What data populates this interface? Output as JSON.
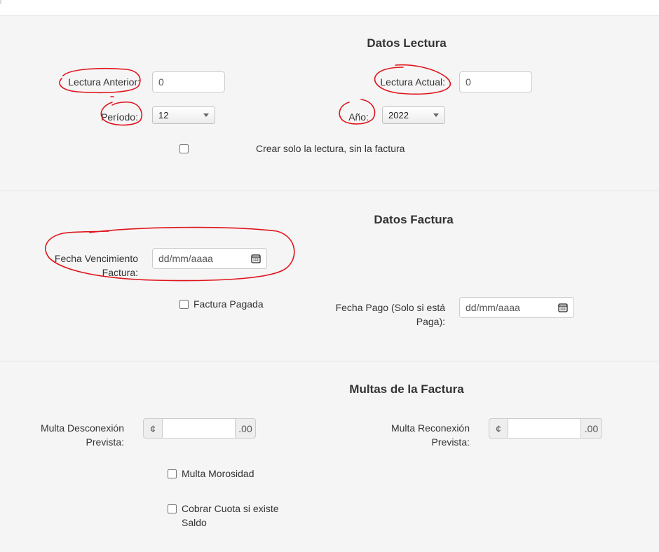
{
  "lectura": {
    "title": "Datos Lectura",
    "anterior_label": "Lectura Anterior:",
    "anterior_value": "0",
    "actual_label": "Lectura Actual:",
    "actual_value": "0",
    "periodo_label": "Período:",
    "periodo_value": "12",
    "anio_label": "Año:",
    "anio_value": "2022",
    "solo_lectura_label": "Crear solo la lectura, sin la factura"
  },
  "factura": {
    "title": "Datos Factura",
    "vencimiento_label_line1": "Fecha Vencimiento",
    "vencimiento_label_line2": "Factura:",
    "vencimiento_placeholder": "dd/mm/aaaa",
    "pagada_label": "Factura Pagada",
    "pago_label_line1": "Fecha Pago (Solo si está",
    "pago_label_line2": "Paga):",
    "pago_placeholder": "dd/mm/aaaa"
  },
  "multas": {
    "title": "Multas de la Factura",
    "desconexion_label_line1": "Multa Desconexión",
    "desconexion_label_line2": "Prevista:",
    "reconexion_label_line1": "Multa Reconexión",
    "reconexion_label_line2": "Prevista:",
    "currency_symbol": "¢",
    "decimal_suffix": ".00",
    "morosidad_label": "Multa Morosidad",
    "cobrar_label_line1": "Cobrar Cuota si existe",
    "cobrar_label_line2": "Saldo"
  },
  "icons": {
    "calendar": "calendar-icon",
    "dropdown": "chevron-down-icon"
  },
  "colors": {
    "background": "#f5f5f5",
    "annotation": "#e0141c"
  }
}
